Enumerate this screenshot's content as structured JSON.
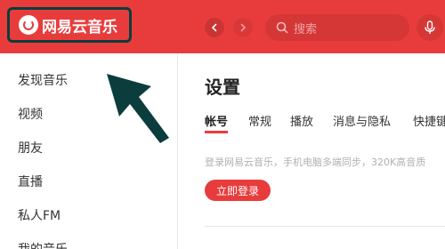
{
  "app": {
    "logo_text": "网易云音乐",
    "search_placeholder": "搜索"
  },
  "sidebar": {
    "items": [
      {
        "label": "发现音乐"
      },
      {
        "label": "视频"
      },
      {
        "label": "朋友"
      },
      {
        "label": "直播"
      },
      {
        "label": "私人FM"
      },
      {
        "label": "我的音乐"
      }
    ]
  },
  "settings": {
    "title": "设置",
    "tabs": [
      {
        "label": "帐号",
        "active": true
      },
      {
        "label": "常规"
      },
      {
        "label": "播放"
      },
      {
        "label": "消息与隐私"
      },
      {
        "label": "快捷键"
      }
    ],
    "login_description": "登录网易云音乐，手机电脑多端同步，320K高音质",
    "login_button": "立即登录"
  },
  "colors": {
    "brand_red": "#e83c3c",
    "annotation": "#0b3d3d"
  },
  "icons": {
    "back": "chevron-left-icon",
    "forward": "chevron-right-icon",
    "search": "search-icon",
    "mic": "microphone-icon",
    "logo": "netease-music-logo-icon",
    "annotation_arrow": "arrow-pointer-icon"
  }
}
